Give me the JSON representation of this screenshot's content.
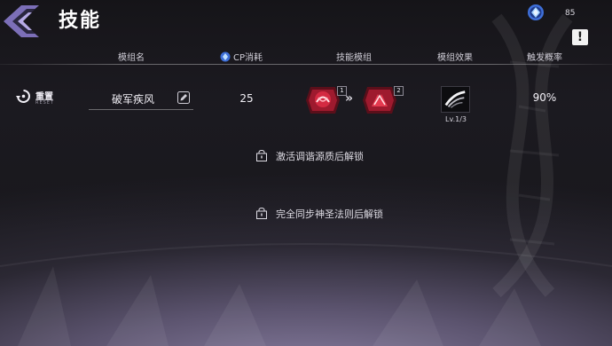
{
  "header": {
    "title": "技能",
    "currency": {
      "icon": "crystal-icon",
      "value": "85"
    },
    "alert_icon": "alert-icon",
    "alert_glyph": "!"
  },
  "columns": {
    "module_name": "模组名",
    "cp_cost": "CP消耗",
    "skill_module": "技能模组",
    "module_effect": "模组效果",
    "trigger_rate": "触发概率"
  },
  "row": {
    "reset_label": "重置",
    "reset_sub": "RESET",
    "module_name": "破军疾风",
    "cp_value": "25",
    "skill_slots": [
      {
        "icon": "crimson-skill-icon",
        "badge": "1"
      },
      {
        "icon": "crimson-skill-icon",
        "badge": "2"
      }
    ],
    "chevrons": "»",
    "effect_icon": "wind-slash-icon",
    "effect_level": "Lv.1/3",
    "rate": "90%"
  },
  "locked_slots": [
    {
      "text": "激活调谐源质后解锁"
    },
    {
      "text": "完全同步神圣法则后解锁"
    }
  ],
  "colors": {
    "accent_purple": "#8c7ec2",
    "skill_red": "#e5324a",
    "text": "#e8e6ee"
  }
}
